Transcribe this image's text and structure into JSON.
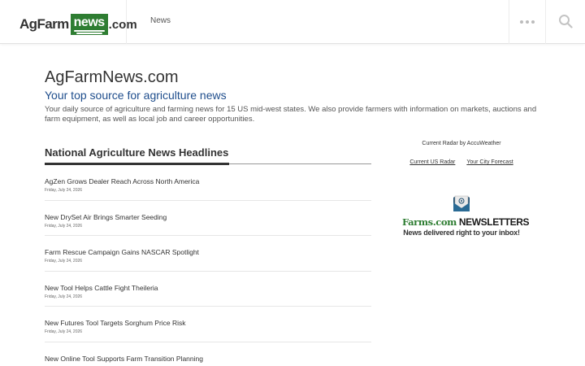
{
  "header": {
    "logo": {
      "part1": "AgFarm",
      "part2": "news",
      "part3": ".com"
    },
    "nav": [
      {
        "label": "News"
      }
    ],
    "icons": {
      "more": "more-dots-icon",
      "search": "search-icon"
    }
  },
  "intro": {
    "title": "AgFarmNews.com",
    "tagline": "Your top source for agriculture news",
    "description": "Your daily source of agriculture and farming news for 15 US mid-west states. We also provide farmers with information on markets, auctions and farm equipment, as well as local job and career opportunities."
  },
  "headlines": {
    "title": "National Agriculture News Headlines",
    "items": [
      {
        "title": "AgZen Grows Dealer Reach Across North America",
        "date": "Friday, July 24, 2026"
      },
      {
        "title": "New DrySet Air Brings Smarter Seeding",
        "date": "Friday, July 24, 2026"
      },
      {
        "title": "Farm Rescue Campaign Gains NASCAR Spotlight",
        "date": "Friday, July 24, 2026"
      },
      {
        "title": "New Tool Helps Cattle Fight Theileria",
        "date": "Friday, July 24, 2026"
      },
      {
        "title": "New Futures Tool Targets Sorghum Price Risk",
        "date": "Friday, July 24, 2026"
      },
      {
        "title": "New Online Tool Supports Farm Transition Planning",
        "date": ""
      }
    ]
  },
  "sidebar": {
    "radar_label": "Current Radar by AccuWeather",
    "links": [
      {
        "label": "Current US Radar"
      },
      {
        "label": "Your City Forecast"
      }
    ],
    "newsletter": {
      "brand": "Farms.com",
      "label": "NEWSLETTERS",
      "tagline": "News delivered right to your inbox!"
    }
  },
  "colors": {
    "brand_green": "#2e7d32",
    "tagline_blue": "#1e4d8c",
    "text": "#333333"
  }
}
